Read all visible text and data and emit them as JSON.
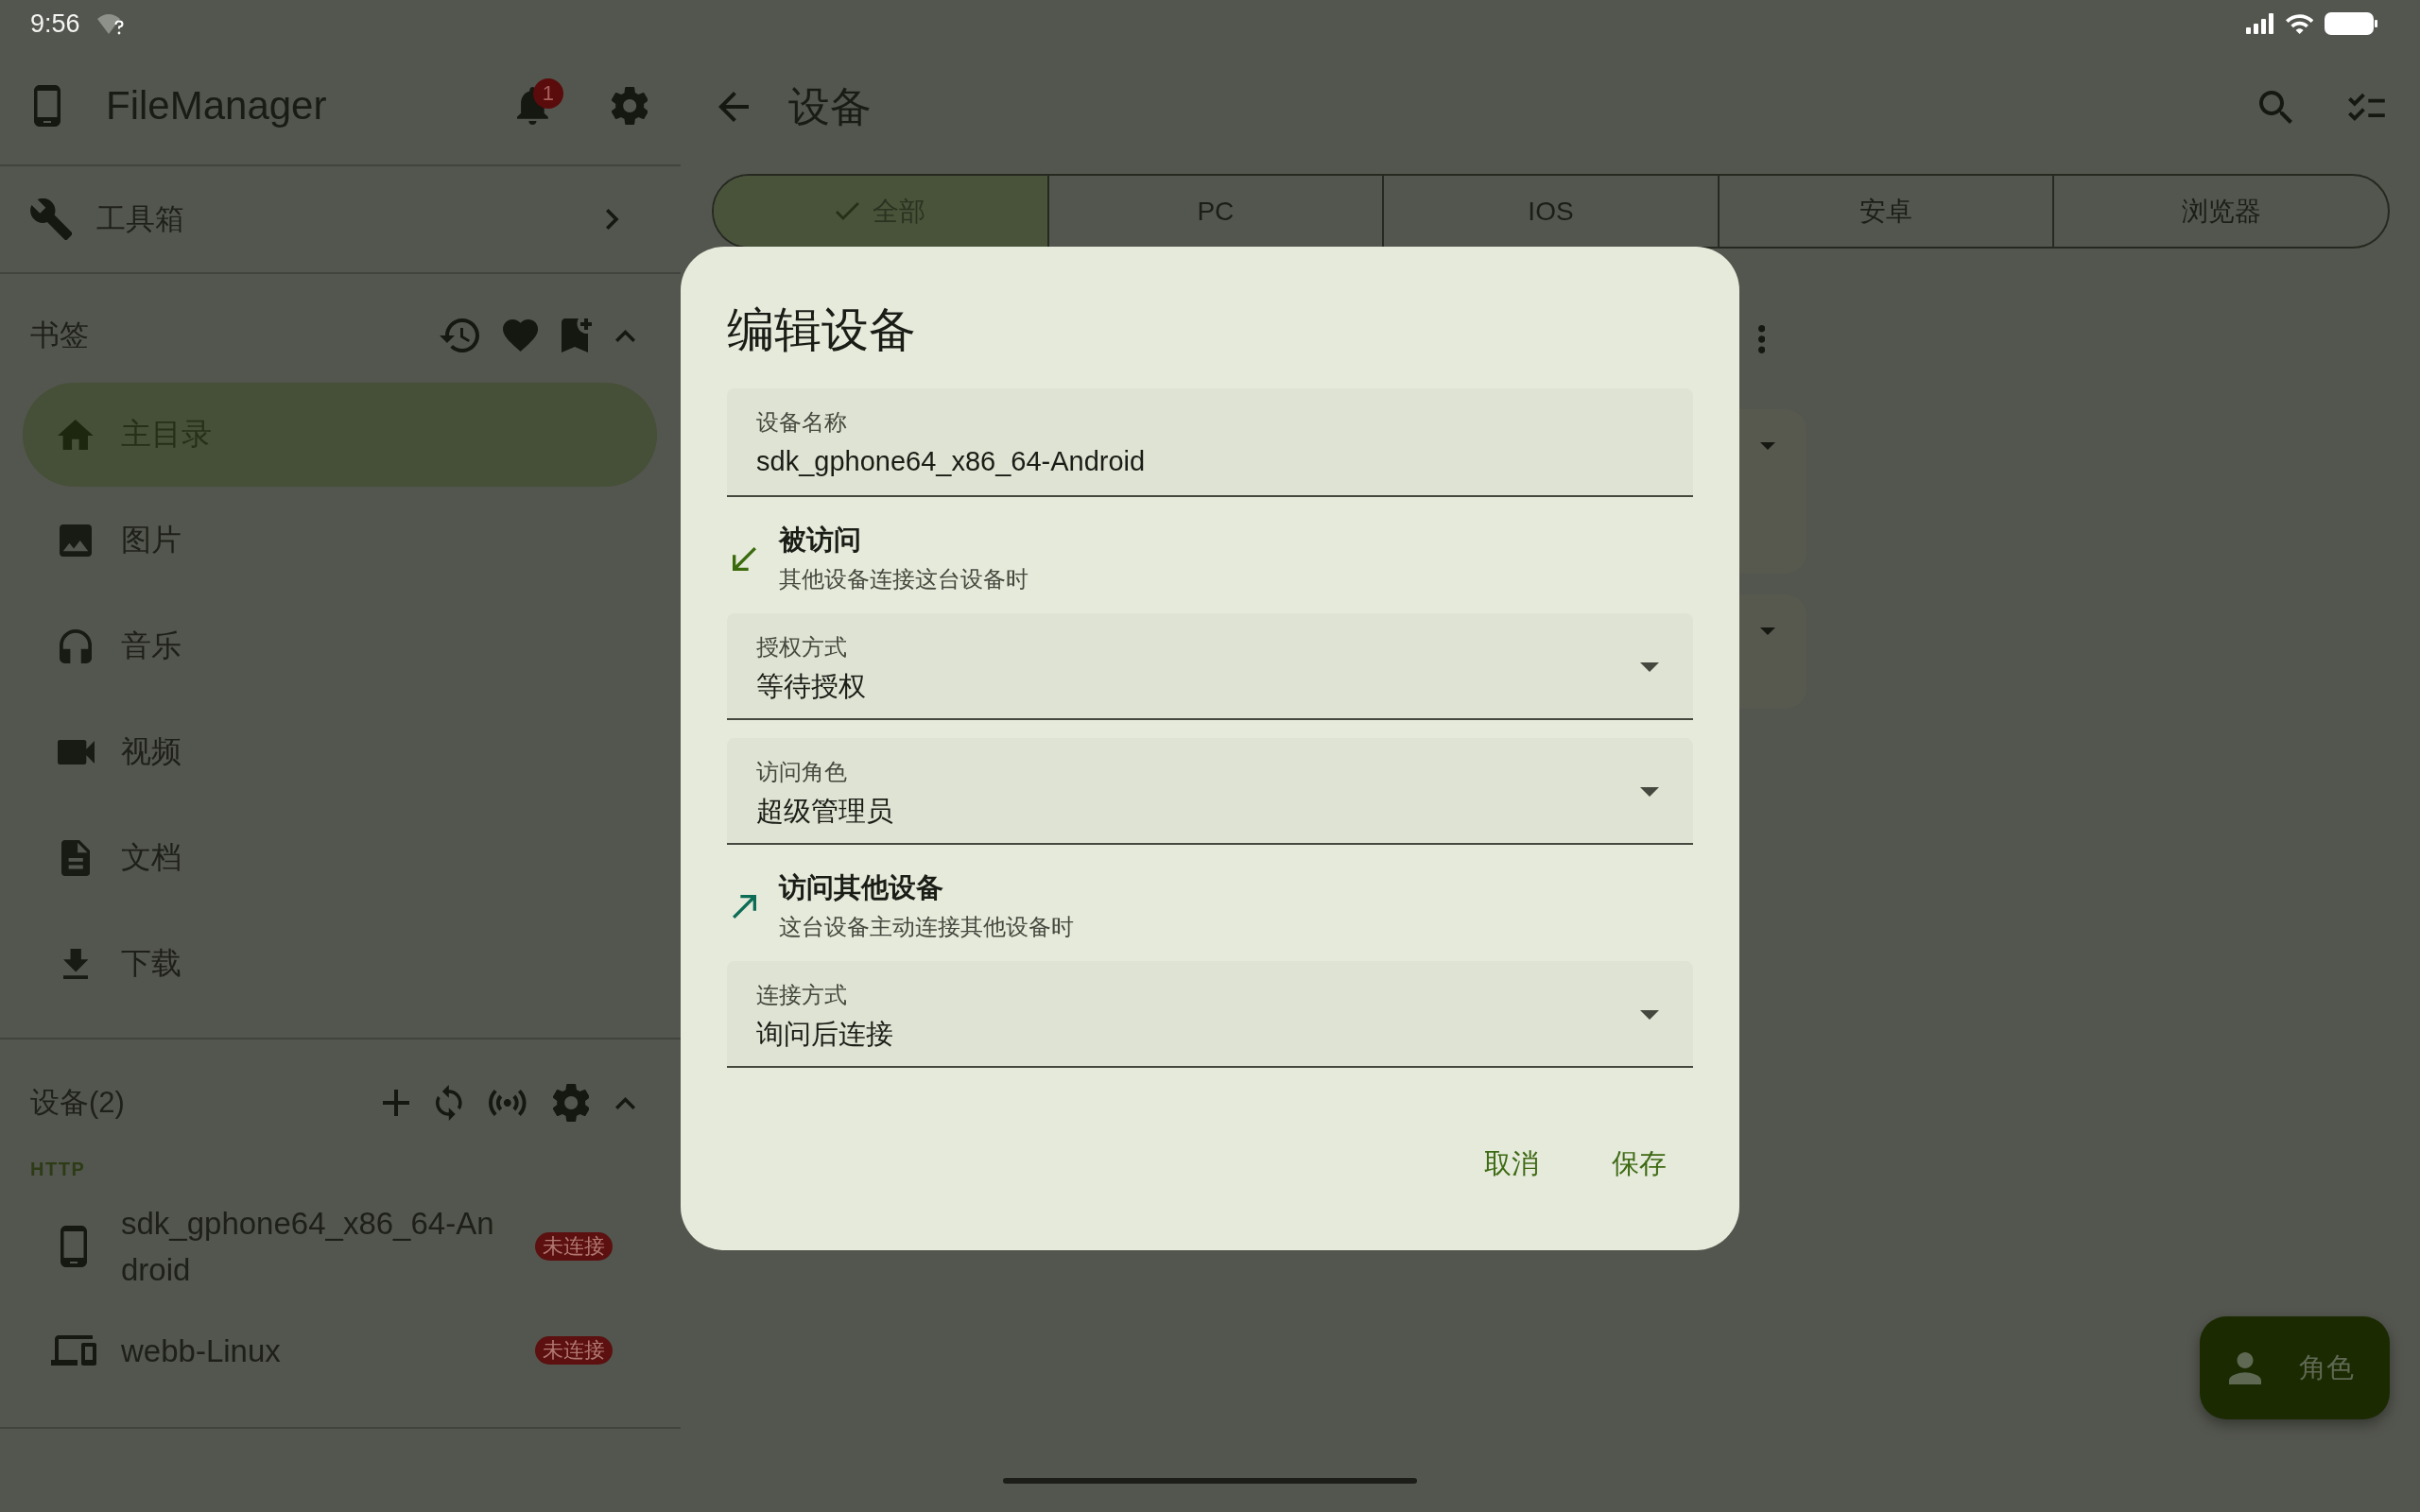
{
  "status_bar": {
    "time": "9:56"
  },
  "sidebar": {
    "app_title": "FileManager",
    "notification_count": "1",
    "toolbox": {
      "label": "工具箱"
    },
    "bookmarks": {
      "title": "书签",
      "expanded": true,
      "items": [
        {
          "label": "主目录",
          "selected": true
        },
        {
          "label": "图片",
          "selected": false
        },
        {
          "label": "音乐",
          "selected": false
        },
        {
          "label": "视频",
          "selected": false
        },
        {
          "label": "文档",
          "selected": false
        },
        {
          "label": "下载",
          "selected": false
        }
      ]
    },
    "devices": {
      "title": "设备(2)",
      "expanded": true,
      "group": "HTTP",
      "items": [
        {
          "name": "sdk_gphone64_x86_64-Android",
          "status": "未连接"
        },
        {
          "name": "webb-Linux",
          "status": "未连接"
        }
      ]
    }
  },
  "header": {
    "title": "设备"
  },
  "tabs": [
    {
      "label": "全部",
      "selected": true
    },
    {
      "label": "PC",
      "selected": false
    },
    {
      "label": "IOS",
      "selected": false
    },
    {
      "label": "安卓",
      "selected": false
    },
    {
      "label": "浏览器",
      "selected": false
    }
  ],
  "dialog": {
    "title": "编辑设备",
    "name_field": {
      "label": "设备名称",
      "value": "sdk_gphone64_x86_64-Android"
    },
    "sections": [
      {
        "title": "被访问",
        "subtitle": "其他设备连接这台设备时",
        "dropdowns": [
          {
            "label": "授权方式",
            "value": "等待授权"
          },
          {
            "label": "访问角色",
            "value": "超级管理员"
          }
        ]
      },
      {
        "title": "访问其他设备",
        "subtitle": "这台设备主动连接其他设备时",
        "dropdowns": [
          {
            "label": "连接方式",
            "value": "询问后连接"
          }
        ]
      }
    ],
    "buttons": [
      "取消",
      "保存"
    ]
  },
  "fab": {
    "label": "角色"
  }
}
